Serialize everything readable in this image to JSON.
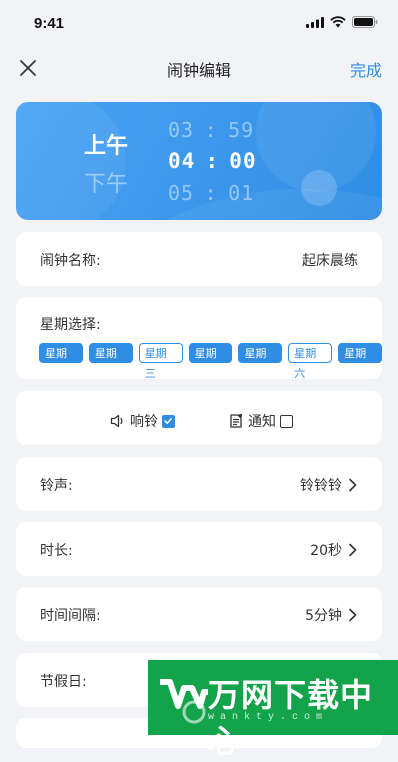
{
  "status": {
    "time": "9:41"
  },
  "nav": {
    "title": "闹钟编辑",
    "done": "完成"
  },
  "time_picker": {
    "period_active": "上午",
    "period_other": "下午",
    "prev": {
      "hour": "03",
      "minute": "59"
    },
    "current": {
      "hour": "04",
      "minute": "00"
    },
    "next": {
      "hour": "05",
      "minute": "01"
    },
    "separator": ":"
  },
  "alarm_name": {
    "label": "闹钟名称:",
    "value": "起床晨练"
  },
  "week": {
    "label": "星期选择:",
    "days": [
      {
        "label": "星期一",
        "selected": true
      },
      {
        "label": "星期二",
        "selected": true
      },
      {
        "label": "星期三",
        "selected": false
      },
      {
        "label": "星期四",
        "selected": true
      },
      {
        "label": "星期五",
        "selected": true
      },
      {
        "label": "星期六",
        "selected": false
      },
      {
        "label": "星期日",
        "selected": true
      }
    ]
  },
  "options": {
    "ring": {
      "label": "响铃",
      "checked": true,
      "icon": "speaker-icon"
    },
    "notify": {
      "label": "通知",
      "checked": false,
      "icon": "notification-icon"
    }
  },
  "rows": {
    "ringtone": {
      "label": "铃声:",
      "value": "铃铃铃"
    },
    "duration": {
      "label": "时长:",
      "value": "20秒"
    },
    "interval": {
      "label": "时间间隔:",
      "value": "5分钟"
    },
    "holiday": {
      "label": "节假日:"
    }
  },
  "watermark": {
    "text": "万网下载中心",
    "sub": "wankty.com"
  },
  "colors": {
    "accent": "#2f8de4",
    "background": "#f2f3f7",
    "watermark": "#13a34a"
  }
}
